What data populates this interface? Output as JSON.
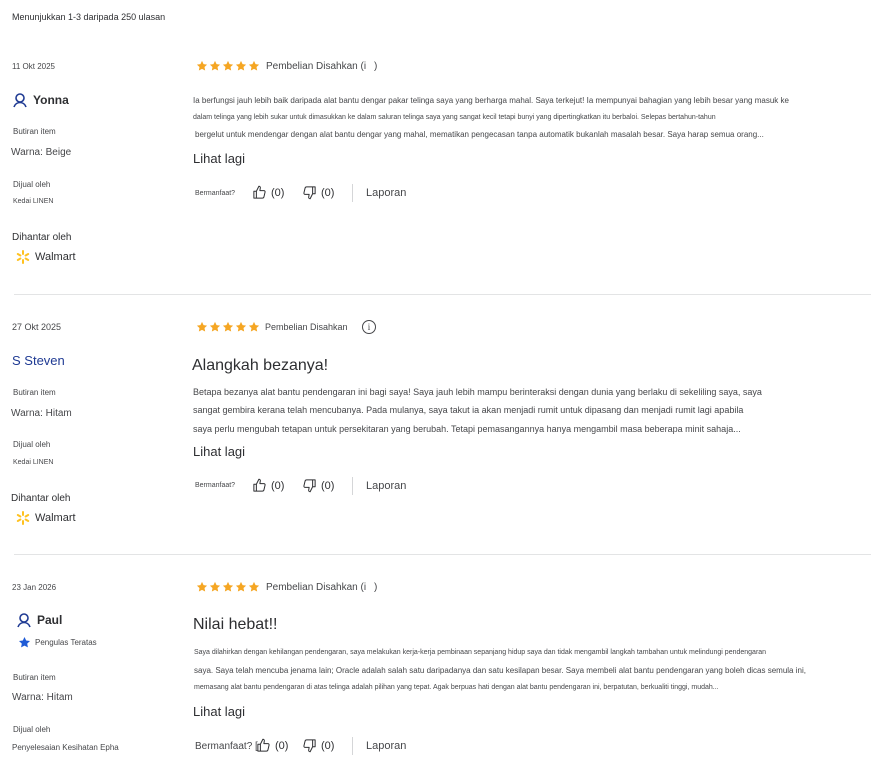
{
  "summary": "Menunjukkan 1-3 daripada 250 ulasan",
  "labels": {
    "item_details": "Butiran item",
    "sold_by": "Dijual oleh",
    "delivered_by": "Dihantar oleh",
    "helpful": "Bermanfaat?",
    "report": "Laporan",
    "see_more": "Lihat lagi"
  },
  "reviews": [
    {
      "date": "11 Okt 2025",
      "rating": 5,
      "verified": "Pembelian Disahkan (i",
      "reviewer": "Yonna",
      "variant": "Warna: Beige",
      "seller": "Kedai LINEN",
      "delivery": "Walmart",
      "body_lines": [
        "Ia berfungsi jauh lebih baik daripada alat bantu dengar pakar telinga saya yang berharga mahal. Saya terkejut! Ia mempunyai bahagian yang lebih besar yang masuk ke",
        "dalam telinga yang lebih sukar untuk dimasukkan ke dalam saluran telinga saya yang sangat kecil tetapi bunyi yang dipertingkatkan itu berbaloi. Selepas bertahun-tahun",
        "bergelut untuk mendengar dengan alat bantu dengar yang mahal, mematikan pengecasan tanpa automatik bukanlah masalah besar. Saya harap semua orang..."
      ],
      "helpful_count": "(0)",
      "unhelpful_count": "(0)"
    },
    {
      "date": "27 Okt 2025",
      "rating": 5,
      "verified": "Pembelian Disahkan",
      "reviewer": "S Steven",
      "variant": "Warna: Hitam",
      "seller": "Kedai LINEN",
      "delivery": "Walmart",
      "title": "Alangkah bezanya!",
      "body_lines": [
        "Betapa bezanya alat bantu pendengaran ini bagi saya! Saya jauh lebih mampu berinteraksi dengan dunia yang berlaku di sekeliling saya, saya",
        "sangat gembira kerana telah mencubanya. Pada mulanya, saya takut ia akan menjadi rumit untuk dipasang dan menjadi rumit lagi apabila",
        "saya perlu mengubah tetapan untuk persekitaran yang berubah. Tetapi pemasangannya hanya mengambil masa beberapa minit sahaja..."
      ],
      "helpful_count": "(0)",
      "unhelpful_count": "(0)"
    },
    {
      "date": "23 Jan 2026",
      "rating": 5,
      "verified": "Pembelian Disahkan (i",
      "reviewer": "Paul",
      "badge": "Pengulas Teratas",
      "variant": "Warna: Hitam",
      "seller": "Penyelesaian Kesihatan Epha",
      "title": "Nilai hebat!!",
      "body_lines": [
        "Saya dilahirkan dengan kehilangan pendengaran, saya melakukan kerja-kerja pembinaan sepanjang hidup saya dan tidak mengambil langkah tambahan untuk melindungi pendengaran",
        "saya. Saya telah mencuba jenama lain; Oracle adalah salah satu daripadanya dan satu kesilapan besar. Saya membeli alat bantu pendengaran yang boleh dicas semula ini,",
        "memasang alat bantu pendengaran di atas telinga adalah pilihan yang tepat. Agak berpuas hati dengan alat bantu pendengaran ini, berpatutan, berkualiti tinggi, mudah..."
      ],
      "helpful_label": "Bermanfaat? [",
      "helpful_count": "(0)",
      "unhelpful_count": "(0)"
    }
  ],
  "colors": {
    "star": "#f5a623",
    "text": "#2e2f32",
    "muted": "#46474a",
    "walmart": "#ffc220",
    "badge": "#1f5bd6"
  }
}
